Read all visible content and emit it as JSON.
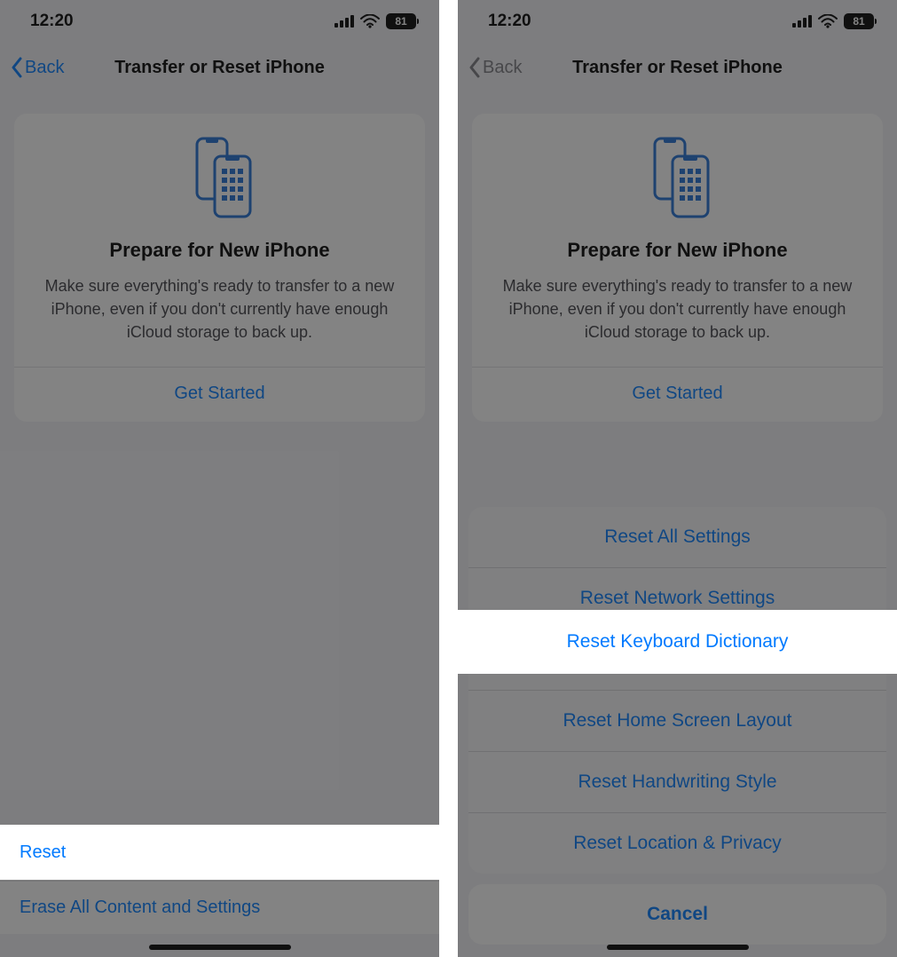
{
  "status": {
    "time": "12:20",
    "battery": "81"
  },
  "nav": {
    "back": "Back",
    "title": "Transfer or Reset iPhone"
  },
  "card": {
    "title": "Prepare for New iPhone",
    "desc": "Make sure everything's ready to transfer to a new iPhone, even if you don't currently have enough iCloud storage to back up.",
    "cta": "Get Started"
  },
  "rows": {
    "reset": "Reset",
    "erase": "Erase All Content and Settings"
  },
  "sheet": {
    "items": [
      "Reset All Settings",
      "Reset Network Settings",
      "Reset Keyboard Dictionary",
      "Reset Home Screen Layout",
      "Reset Handwriting Style",
      "Reset Location & Privacy"
    ],
    "cancel": "Cancel"
  }
}
